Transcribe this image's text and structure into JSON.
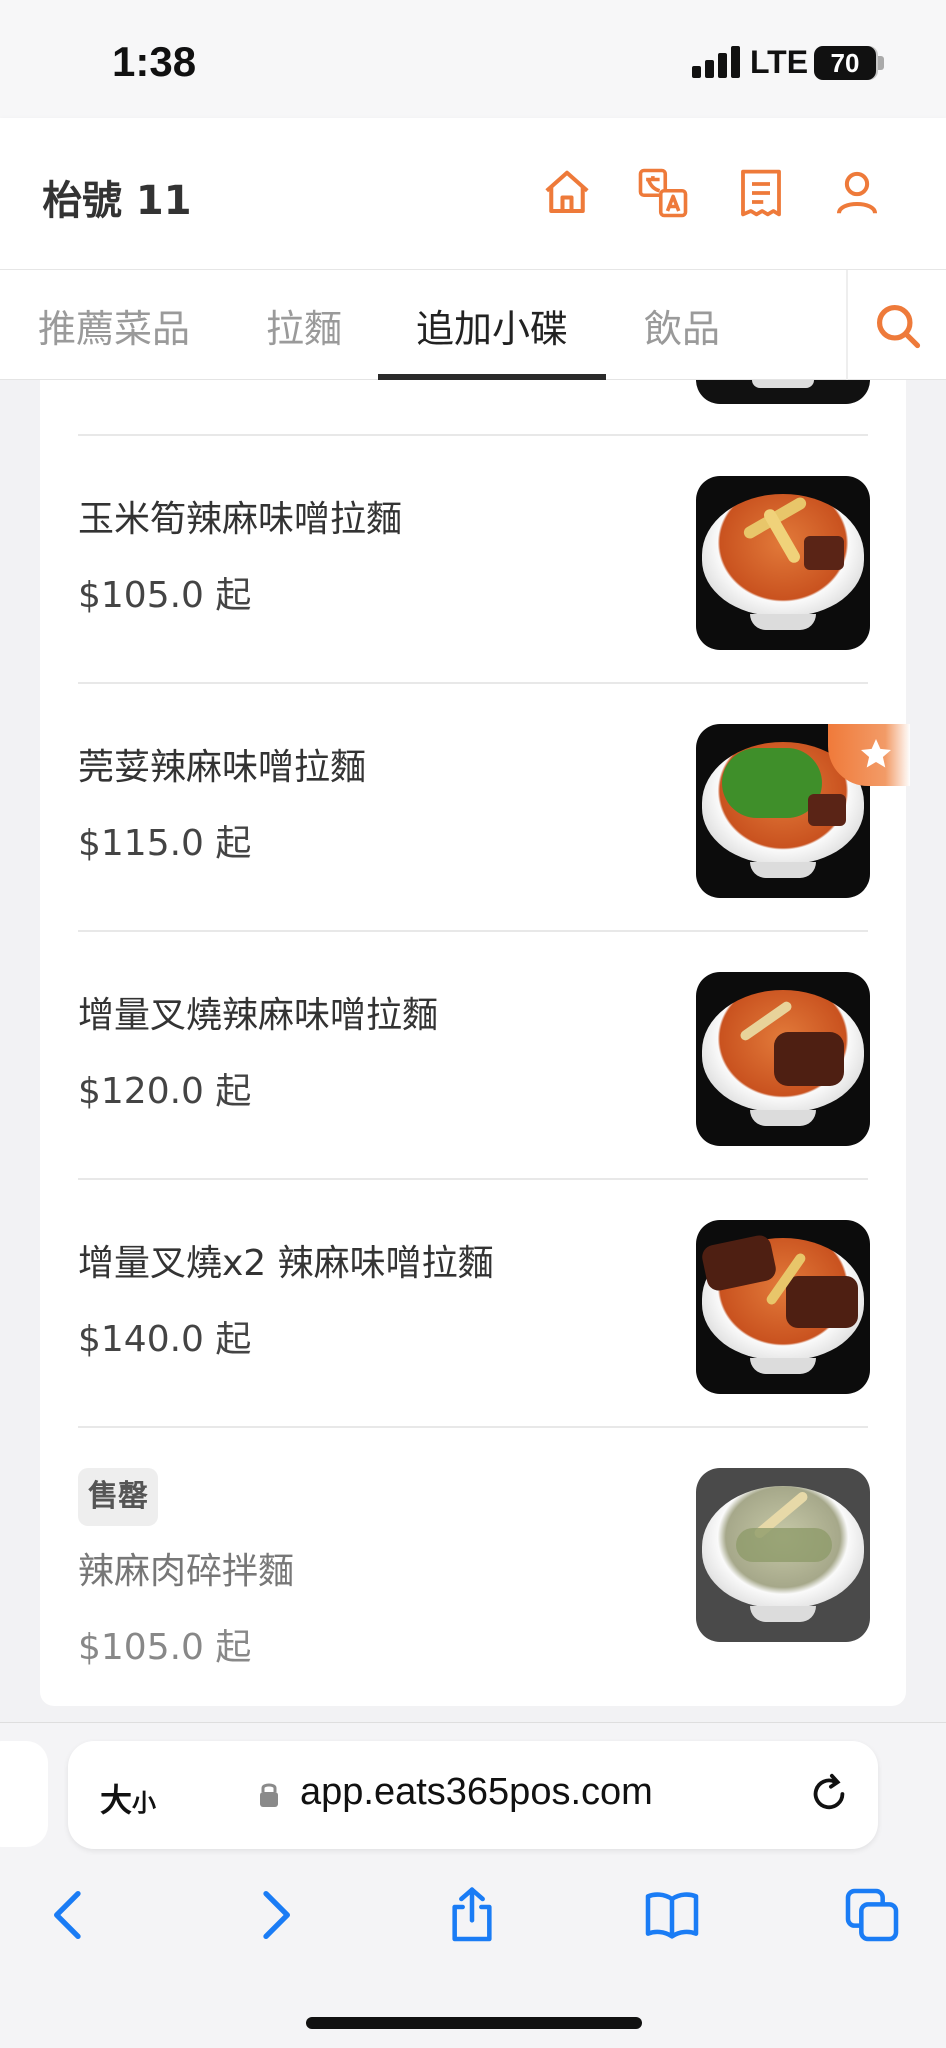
{
  "status_bar": {
    "time": "1:38",
    "network": "LTE",
    "battery": "70"
  },
  "header": {
    "table_label": "枱號 11",
    "icons": [
      "home-icon",
      "translate-icon",
      "receipt-icon",
      "user-icon"
    ]
  },
  "tabs": [
    {
      "label": "推薦菜品",
      "active": false
    },
    {
      "label": "拉麵",
      "active": false
    },
    {
      "label": "追加小碟",
      "active": true
    },
    {
      "label": "飲品",
      "active": false
    }
  ],
  "menu_items": [
    {
      "name": "玉米筍辣麻味噌拉麵",
      "price": "$105.0 起",
      "sold_out": false,
      "featured": false
    },
    {
      "name": "莞荽辣麻味噌拉麵",
      "price": "$115.0 起",
      "sold_out": false,
      "featured": true
    },
    {
      "name": "增量叉燒辣麻味噌拉麵",
      "price": "$120.0 起",
      "sold_out": false,
      "featured": false
    },
    {
      "name": "增量叉燒x2 辣麻味噌拉麵",
      "price": "$140.0 起",
      "sold_out": false,
      "featured": false
    },
    {
      "name": "辣麻肉碎拌麵",
      "price": "$105.0 起",
      "sold_out": true,
      "sold_out_label": "售罄",
      "featured": false
    }
  ],
  "browser": {
    "text_size_label": "大",
    "text_size_small": "小",
    "url": "app.eats365pos.com"
  },
  "colors": {
    "accent": "#ee7a3a",
    "safari_blue": "#1a7cf5"
  }
}
